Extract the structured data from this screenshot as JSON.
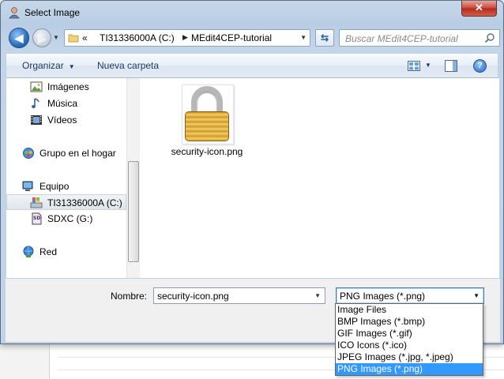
{
  "window": {
    "title": "Select Image",
    "close_label": "✕"
  },
  "nav": {
    "address": {
      "prefix": "«",
      "drive": "TI31336000A (C:)",
      "folder": "MEdit4CEP-tutorial"
    },
    "search_placeholder": "Buscar MEdit4CEP-tutorial"
  },
  "toolbar": {
    "organize": "Organizar",
    "new_folder": "Nueva carpeta"
  },
  "sidebar": {
    "items": [
      {
        "label": "Imágenes",
        "icon": "pictures-icon"
      },
      {
        "label": "Música",
        "icon": "music-icon"
      },
      {
        "label": "Vídeos",
        "icon": "videos-icon"
      },
      {
        "label": "Grupo en el hogar",
        "icon": "homegroup-icon"
      },
      {
        "label": "Equipo",
        "icon": "computer-icon"
      },
      {
        "label": "TI31336000A (C:)",
        "icon": "drive-icon",
        "selected": true
      },
      {
        "label": "SDXC (G:)",
        "icon": "sd-card-icon"
      },
      {
        "label": "Red",
        "icon": "network-icon"
      }
    ]
  },
  "files": [
    {
      "name": "security-icon.png",
      "icon": "lock-icon"
    }
  ],
  "footer": {
    "name_label": "Nombre:",
    "name_value": "security-icon.png",
    "type_value": "PNG Images (*.png)"
  },
  "file_types": [
    "Image Files",
    "BMP Images (*.bmp)",
    "GIF Images (*.gif)",
    "ICO Icons (*.ico)",
    "JPEG Images (*.jpg, *.jpeg)",
    "PNG Images (*.png)"
  ],
  "colors": {
    "selection": "#3399ff",
    "accent": "#2a6cc0"
  }
}
